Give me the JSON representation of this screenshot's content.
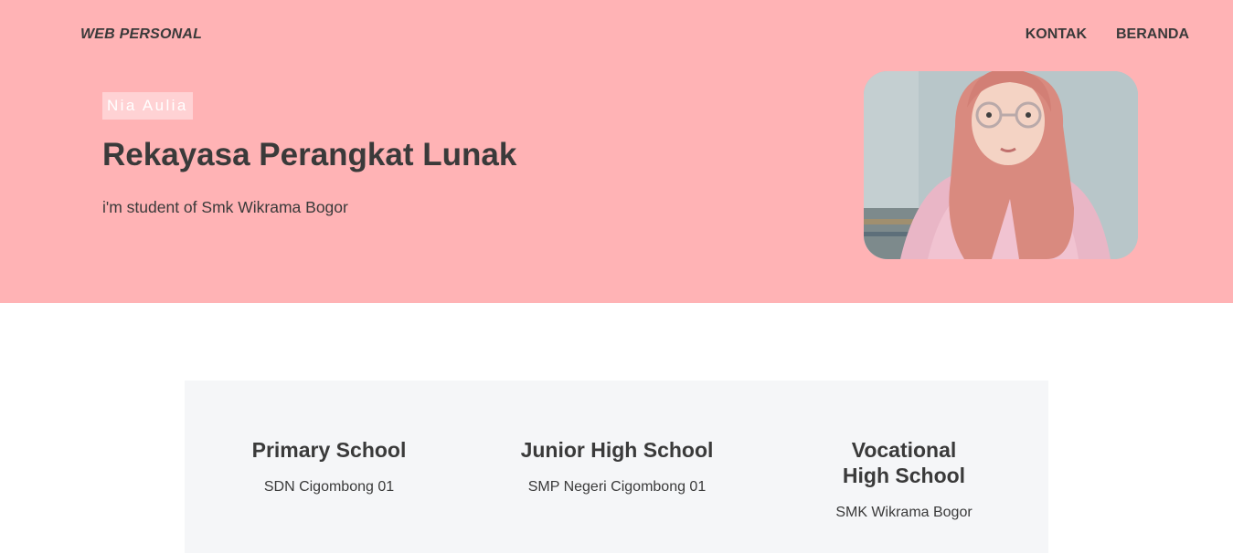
{
  "header": {
    "brand": "WEB PERSONAL",
    "nav": [
      "KONTAK",
      "BERANDA"
    ]
  },
  "hero": {
    "name": "Nia Aulia",
    "title": "Rekayasa Perangkat Lunak",
    "subtitle": "i'm student of Smk Wikrama Bogor",
    "background_color": "#ffb3b5"
  },
  "education": [
    {
      "title": "Primary School",
      "school": "SDN Cigombong 01"
    },
    {
      "title": "Junior High School",
      "school": "SMP Negeri Cigombong 01"
    },
    {
      "title": "Vocational High School",
      "school": "SMK Wikrama Bogor"
    }
  ],
  "colors": {
    "accent": "#ffb3b5",
    "text": "#3a3a3a",
    "section_bg": "#f5f6f8"
  }
}
